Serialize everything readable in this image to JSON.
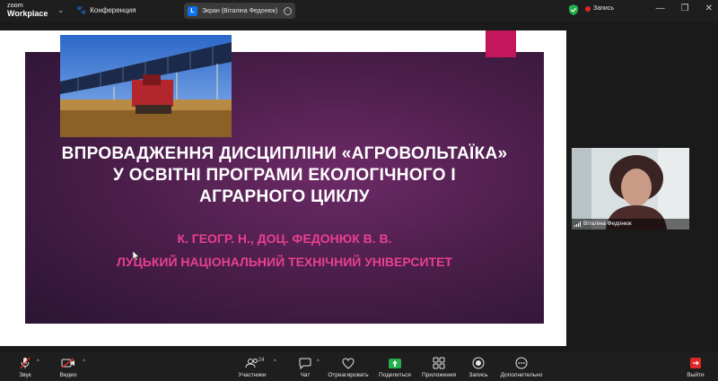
{
  "app": {
    "logo_line1": "zoom",
    "logo_line2": "Workplace"
  },
  "titlebar": {
    "meeting_label": "Конференция",
    "screen_badge": "L",
    "screen_title": "Экран (Віталіна Федонюк)",
    "recording_label": "Запись"
  },
  "slide": {
    "title_lines": [
      "ВПРОВАДЖЕННЯ ДИСЦИПЛІНИ «АГРОВОЛЬТАЇКА»",
      "У ОСВІТНІ ПРОГРАМИ ЕКОЛОГІЧНОГО І",
      "АГРАРНОГО ЦИКЛУ"
    ],
    "author": "К. ГЕОГР. Н., ДОЦ. ФЕДОНЮК В. В.",
    "university": "ЛУЦЬКИЙ НАЦІОНАЛЬНИЙ ТЕХНІЧНИЙ УНІВЕРСИТЕТ"
  },
  "participant": {
    "name": "Віталіна Федонюк"
  },
  "toolbar": {
    "audio": "Звук",
    "video": "Видео",
    "participants": "Участники",
    "participants_count": "24",
    "chat": "Чат",
    "react": "Отреагировать",
    "share": "Поделиться",
    "apps": "Приложения",
    "record": "Запись",
    "more": "Дополнительно",
    "leave": "Выйти"
  },
  "colors": {
    "accent_blue": "#0e72ed",
    "share_green": "#22b14c",
    "record_red": "#e02828",
    "slide_pink": "#e8408e"
  }
}
